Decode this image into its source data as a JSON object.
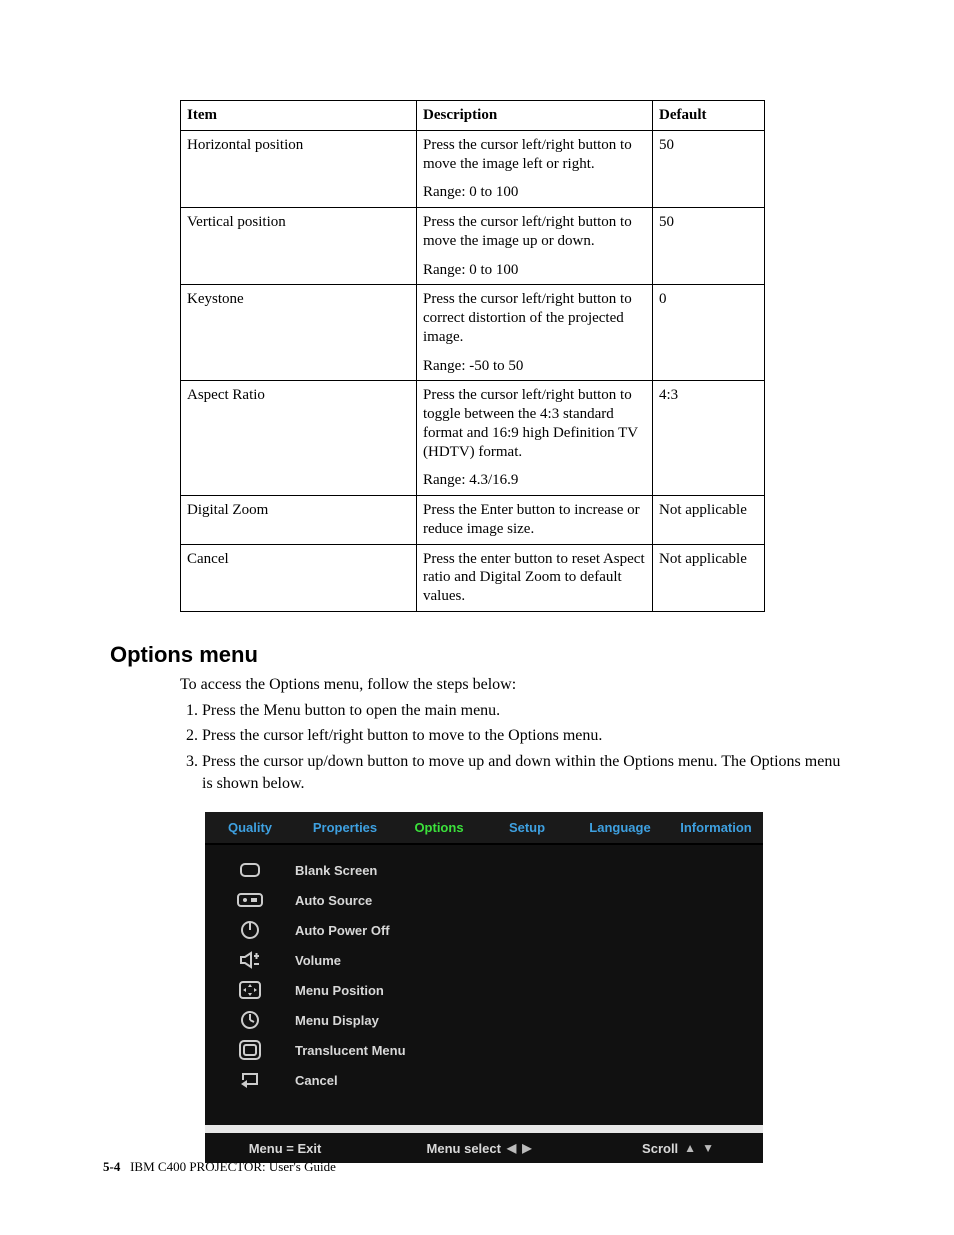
{
  "table": {
    "headers": [
      "Item",
      "Description",
      "Default"
    ],
    "rows": [
      {
        "item": "Horizontal position",
        "desc1": "Press the cursor left/right button to move the image left or right.",
        "range": "Range: 0 to 100",
        "default": "50"
      },
      {
        "item": "Vertical position",
        "desc1": "Press the cursor left/right button to move the image up or down.",
        "range": "Range: 0 to 100",
        "default": "50"
      },
      {
        "item": "Keystone",
        "desc1": "Press the cursor left/right button to correct distortion of the projected image.",
        "range": "Range: -50 to 50",
        "default": "0"
      },
      {
        "item": "Aspect Ratio",
        "desc1": "Press the cursor left/right button to toggle between the 4:3 standard format and 16:9 high Definition TV (HDTV) format.",
        "range": "Range: 4.3/16.9",
        "default": "4:3"
      },
      {
        "item": "Digital Zoom",
        "desc1": "Press the Enter button to increase or reduce image size.",
        "range": "",
        "default": "Not applicable"
      },
      {
        "item": "Cancel",
        "desc1": "Press the enter button to reset Aspect ratio and Digital Zoom to default values.",
        "range": "",
        "default": "Not applicable"
      }
    ]
  },
  "section_heading": "Options menu",
  "intro": "To access the Options menu, follow the steps below:",
  "steps": [
    "Press the Menu button to open the main menu.",
    "Press the cursor left/right button to move to the Options menu.",
    "Press the cursor up/down button to move up and down within the Options menu. The Options menu is shown below."
  ],
  "osd": {
    "tabs": [
      "Quality",
      "Properties",
      "Options",
      "Setup",
      "Language",
      "Information"
    ],
    "active_tab_index": 2,
    "items": [
      "Blank Screen",
      "Auto Source",
      "Auto Power Off",
      "Volume",
      "Menu Position",
      "Menu Display",
      "Translucent Menu",
      "Cancel"
    ],
    "footer": {
      "exit": "Menu = Exit",
      "select": "Menu select",
      "scroll": "Scroll"
    }
  },
  "footer": {
    "page": "5-4",
    "title": "IBM C400 PROJECTOR: User's Guide"
  }
}
